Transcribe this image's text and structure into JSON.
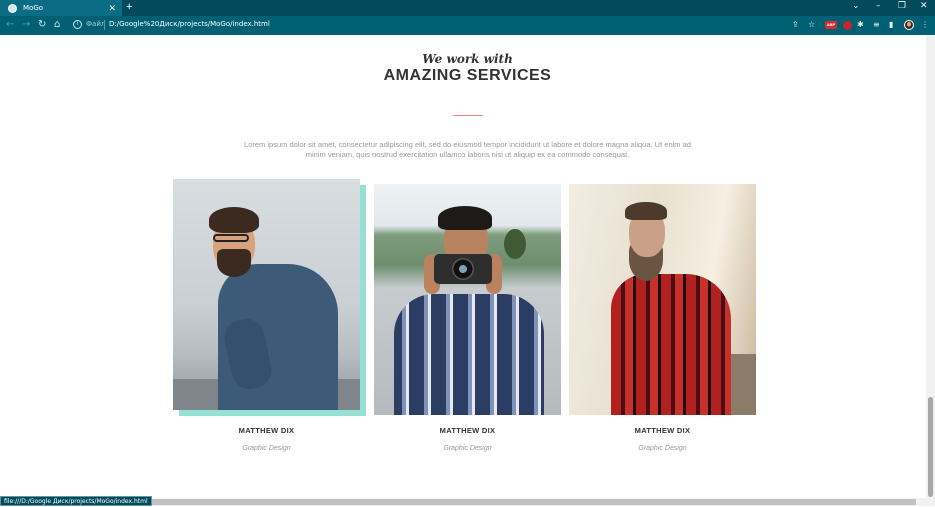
{
  "browser": {
    "tab": {
      "title": "MoGo",
      "close": "✕"
    },
    "new_tab": "+",
    "window_controls": {
      "minimize": "–",
      "restore": "❐",
      "close": "✕",
      "tab_search": "⌄"
    },
    "nav": {
      "back": "←",
      "forward": "→",
      "reload": "↻",
      "home": "⌂"
    },
    "address": {
      "info": "i",
      "scheme_label": "Файл",
      "url": "D:/Google%20Диск/projects/MoGo/index.html"
    },
    "toolbar": {
      "share": "⇪",
      "bookmark": "☆",
      "adblock": "ABP",
      "extensions": "✱",
      "reading_list": "≡",
      "sidepanel": "▮",
      "menu": "⋮"
    },
    "status_url": "file:///D:/Google Диск/projects/MoGo/index.html"
  },
  "section": {
    "subtitle": "We work with",
    "title": "AMAZING SERVICES",
    "accent_color": "#f38181",
    "lead": "Lorem ipsum dolor sit amet, consectetur adipiscing elit, sed do eiusmod tempor incididunt ut labore et dolore magna aliqua. Ut enim ad minim veniam, quis nostrud exercitation ullamco laboris nisi ut aliquip ex ea commodo consequat."
  },
  "team": [
    {
      "name": "MATTHEW DIX",
      "role": "Graphic Design"
    },
    {
      "name": "MATTHEW DIX",
      "role": "Graphic Design"
    },
    {
      "name": "MATTHEW DIX",
      "role": "Graphic Design"
    }
  ]
}
